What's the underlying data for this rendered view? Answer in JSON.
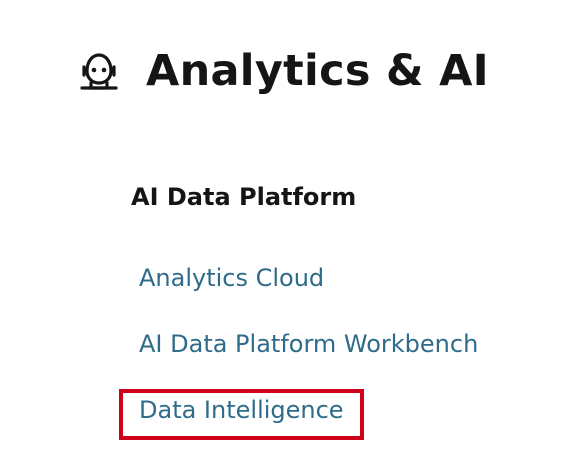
{
  "header": {
    "icon": "robot-head-icon",
    "title": "Analytics & AI"
  },
  "section": {
    "title": "AI Data Platform",
    "links": [
      {
        "label": "Analytics Cloud"
      },
      {
        "label": "AI Data Platform Workbench"
      },
      {
        "label": "Data Intelligence"
      }
    ]
  },
  "highlight": {
    "target": "Data Intelligence",
    "color": "#d0021b"
  },
  "colors": {
    "heading": "#161513",
    "link": "#2f6b8a"
  }
}
